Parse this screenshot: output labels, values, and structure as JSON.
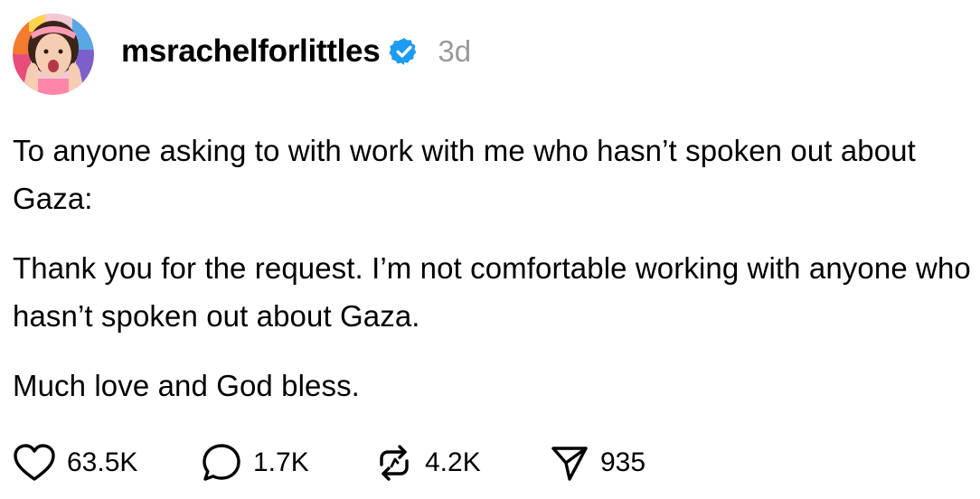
{
  "post": {
    "username": "msrachelforlittles",
    "time": "3d",
    "paragraphs": [
      "To anyone asking to with work with me who hasn’t spoken out about Gaza:",
      "Thank you for the request. I’m not comfortable working with anyone who hasn’t spoken out about Gaza.",
      "Much love and God bless."
    ]
  },
  "stats": {
    "likes": "63.5K",
    "replies": "1.7K",
    "reposts": "4.2K",
    "shares": "935"
  },
  "colors": {
    "verified": "#1d9bf0",
    "muted": "#9a9a9a"
  },
  "icons": {
    "like": "heart-icon",
    "reply": "speech-bubble-icon",
    "repost": "repost-arrows-icon",
    "share": "paper-plane-icon",
    "verified": "verified-badge-icon"
  }
}
